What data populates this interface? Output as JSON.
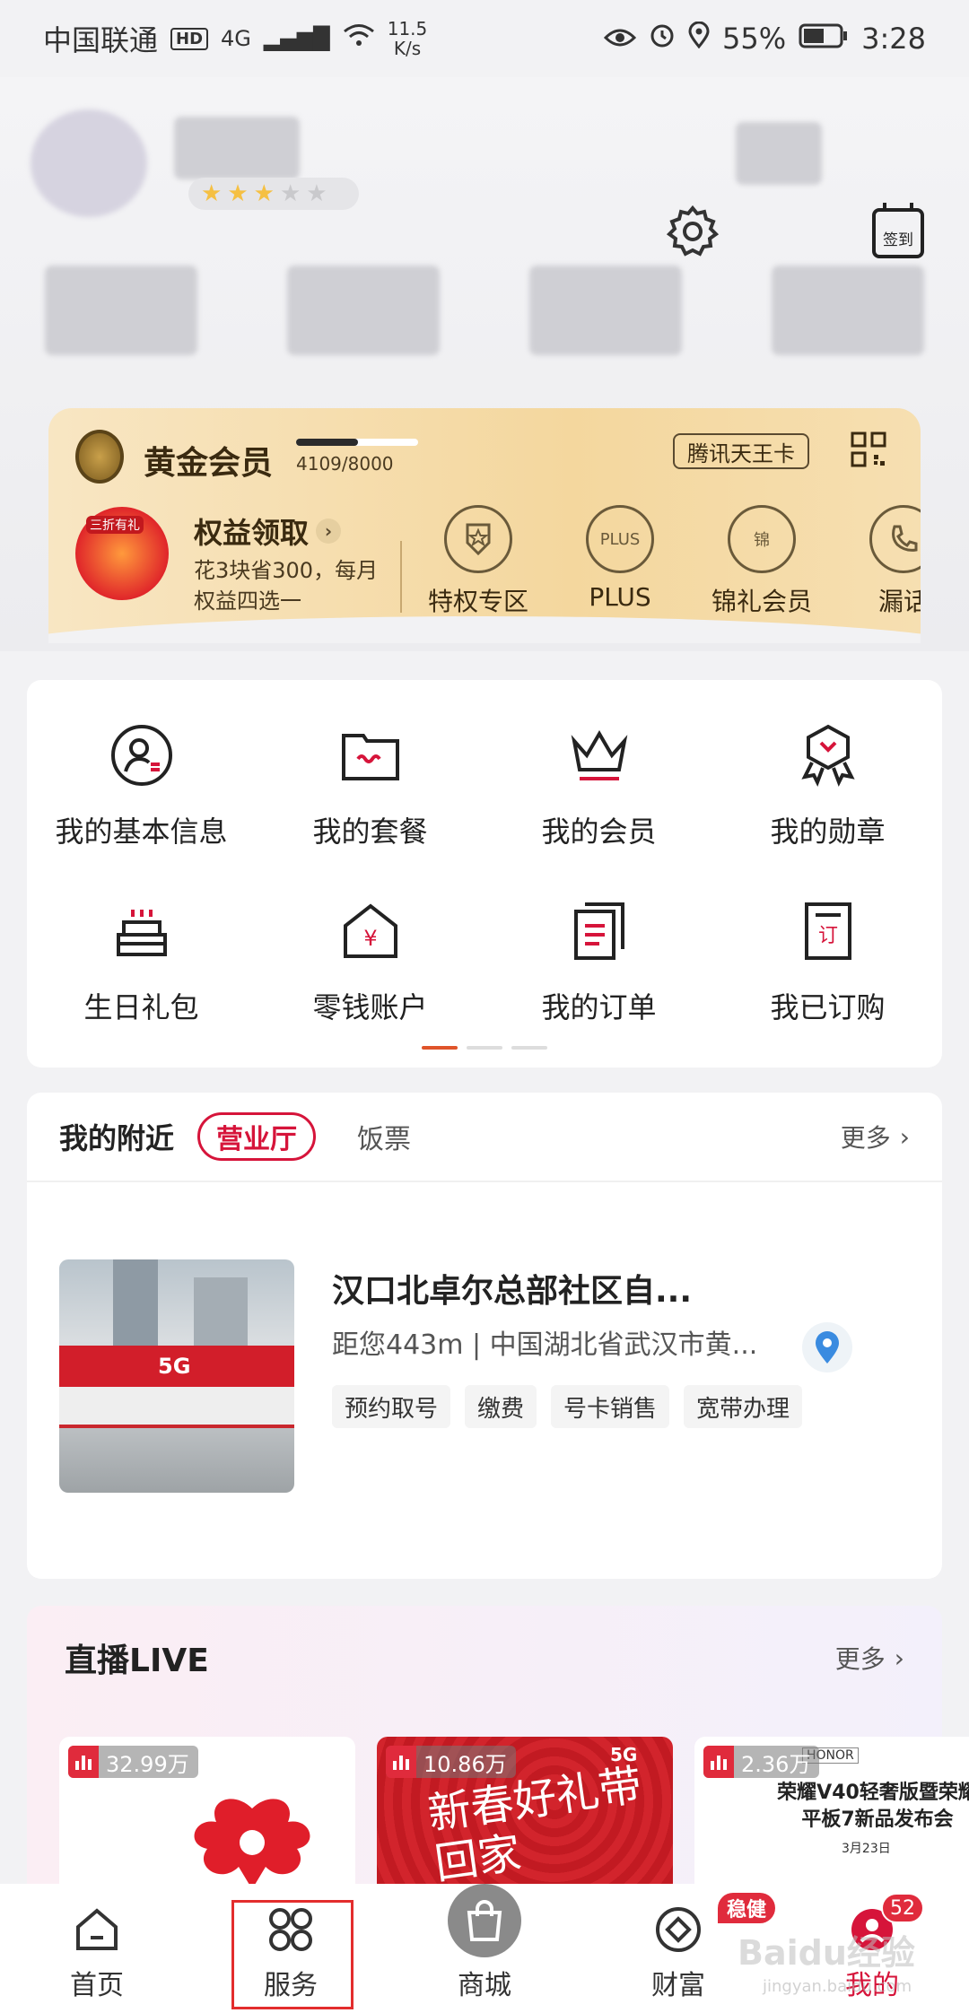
{
  "status_bar": {
    "carrier": "中国联通",
    "hd": "HD",
    "network": "4G",
    "speed_value": "11.5",
    "speed_unit": "K/s",
    "battery": "55%",
    "time": "3:28"
  },
  "header": {
    "signin_label": "签到",
    "stars": {
      "filled": 3,
      "total": 5
    }
  },
  "gold_card": {
    "title": "黄金会员",
    "progress_text": "4109/8000",
    "progress_fraction": 0.51,
    "tencent_card": "腾讯天王卡",
    "fish_tag": "三折有礼",
    "rights_title": "权益领取",
    "rights_desc": "花3块省300，每月权益四选一",
    "perks": [
      {
        "label": "特权专区",
        "icon": "shield-star-icon"
      },
      {
        "label": "PLUS",
        "icon": "crown-plus-icon",
        "icon_text": "PLUS"
      },
      {
        "label": "锦礼会员",
        "icon": "gift-icon",
        "icon_text": "锦"
      },
      {
        "label": "漏话",
        "icon": "phone-icon"
      }
    ]
  },
  "functions": [
    {
      "label": "我的基本信息",
      "icon": "user-info-icon"
    },
    {
      "label": "我的套餐",
      "icon": "package-icon"
    },
    {
      "label": "我的会员",
      "icon": "crown-icon"
    },
    {
      "label": "我的勋章",
      "icon": "medal-icon"
    },
    {
      "label": "生日礼包",
      "icon": "birthday-cake-icon"
    },
    {
      "label": "零钱账户",
      "icon": "wallet-house-icon"
    },
    {
      "label": "我的订单",
      "icon": "orders-icon"
    },
    {
      "label": "我已订购",
      "icon": "subscribed-icon"
    }
  ],
  "nearby": {
    "title": "我的附近",
    "tab_active": "营业厅",
    "tab_other": "饭票",
    "more": "更多",
    "store": {
      "image_sign": "5G",
      "name": "汉口北卓尔总部社区自...",
      "address": "距您443m | 中国湖北省武汉市黄...",
      "tags": [
        "预约取号",
        "缴费",
        "号卡销售",
        "宽带办理"
      ]
    }
  },
  "live": {
    "title": "直播LIVE",
    "more": "更多",
    "cards": [
      {
        "viewers": "32.99万"
      },
      {
        "viewers": "10.86万",
        "art_text": "新春好礼带回家",
        "sign": "5G"
      },
      {
        "viewers": "2.36万",
        "brand": "HONOR",
        "title": "荣耀V40轻奢版暨荣耀平板7新品发布会",
        "date": "3月23日"
      }
    ]
  },
  "bottom_nav": {
    "items": [
      {
        "label": "首页",
        "icon": "home-icon"
      },
      {
        "label": "服务",
        "icon": "services-grid-icon"
      },
      {
        "label": "商城",
        "icon": "shopping-bag-icon"
      },
      {
        "label": "财富",
        "icon": "diamond-icon"
      },
      {
        "label": "我的",
        "icon": "profile-icon"
      }
    ],
    "wealth_badge": "稳健",
    "profile_badge": "52"
  },
  "watermark": {
    "text": "Baidu经验",
    "sub": "jingyan.baidu.com"
  },
  "colors": {
    "brand_red": "#d6143a",
    "gold": "#f4d79e",
    "background": "#f2f2f4"
  }
}
